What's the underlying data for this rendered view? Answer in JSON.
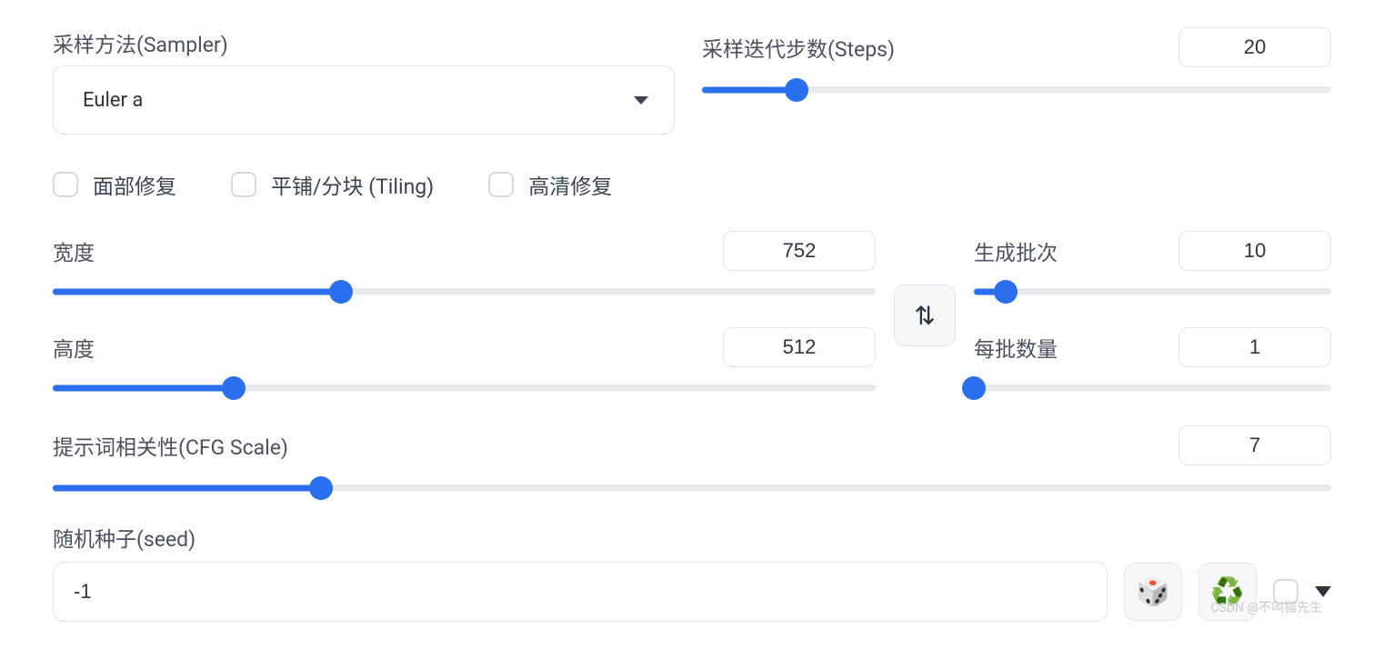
{
  "sampler": {
    "label": "采样方法(Sampler)",
    "value": "Euler a"
  },
  "steps": {
    "label": "采样迭代步数(Steps)",
    "value": "20",
    "percent": 15
  },
  "checkboxes": {
    "face_restore": "面部修复",
    "tiling": "平铺/分块 (Tiling)",
    "hires_fix": "高清修复"
  },
  "width": {
    "label": "宽度",
    "value": "752",
    "percent": 35
  },
  "height": {
    "label": "高度",
    "value": "512",
    "percent": 22
  },
  "batch_count": {
    "label": "生成批次",
    "value": "10",
    "percent": 9
  },
  "batch_size": {
    "label": "每批数量",
    "value": "1",
    "percent": 0
  },
  "cfg": {
    "label": "提示词相关性(CFG Scale)",
    "value": "7",
    "percent": 21
  },
  "seed": {
    "label": "随机种子(seed)",
    "value": "-1"
  },
  "icons": {
    "dice": "🎲",
    "recycle": "♻️",
    "swap": "⇅"
  },
  "watermark": "CSDN @不叫猫先生"
}
